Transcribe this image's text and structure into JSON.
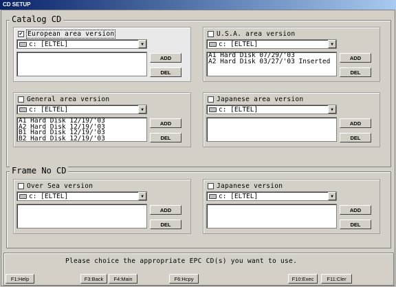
{
  "window": {
    "title": "CD SETUP"
  },
  "groups": {
    "catalog": "Catalog  CD",
    "frame": "Frame No CD"
  },
  "panels": [
    {
      "label": "European area version",
      "checked": true,
      "combo": "c: [ELTEL]",
      "items": []
    },
    {
      "label": "U.S.A. area version",
      "checked": false,
      "combo": "c: [ELTEL]",
      "items": [
        "A1 Hard Disk 07/29/'03",
        "A2 Hard Disk 03/27/'03 Inserted"
      ]
    },
    {
      "label": "General area version",
      "checked": false,
      "combo": "c: [ELTEL]",
      "items": [
        "A1 Hard Disk 12/19/'03",
        "A2 Hard Disk 12/19/'03",
        "B1 Hard Disk 12/19/'03",
        "B2 Hard Disk 12/19/'03"
      ]
    },
    {
      "label": "Japanese area version",
      "checked": false,
      "combo": "c: [ELTEL]",
      "items": []
    },
    {
      "label": "Over Sea version",
      "checked": false,
      "combo": "c: [ELTEL]",
      "items": []
    },
    {
      "label": "Japanese version",
      "checked": false,
      "combo": "c: [ELTEL]",
      "items": []
    }
  ],
  "buttons": {
    "add": "ADD",
    "del": "DEL",
    "check_mark": "✔"
  },
  "status": {
    "message": "Please choice the appropriate EPC CD(s) you want to use."
  },
  "fkeys": [
    "F1:Help",
    "F3:Back",
    "F4:Main",
    "F6:Hcpy",
    "F10:Exec",
    "F11:Cler"
  ]
}
